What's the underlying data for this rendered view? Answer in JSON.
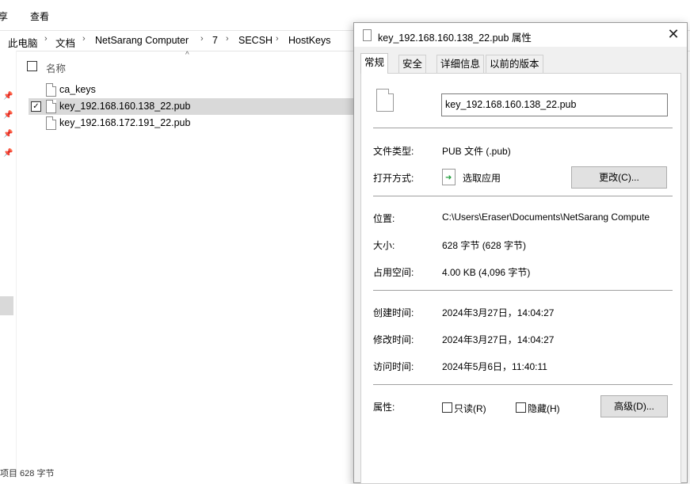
{
  "ribbon": {
    "share_tab": "享",
    "view_tab": "查看"
  },
  "breadcrumb": [
    "此电脑",
    "文档",
    "NetSarang Computer",
    "7",
    "SECSH",
    "HostKeys"
  ],
  "file_list": {
    "column_name": "名称",
    "files": [
      {
        "name": "ca_keys",
        "selected": false
      },
      {
        "name": "key_192.168.160.138_22.pub",
        "selected": true
      },
      {
        "name": "key_192.168.172.191_22.pub",
        "selected": false
      }
    ]
  },
  "status_bar": {
    "text": "项目 628 字节"
  },
  "dialog": {
    "title": "key_192.168.160.138_22.pub 属性",
    "tabs": [
      "常规",
      "安全",
      "详细信息",
      "以前的版本"
    ],
    "active_tab": "常规",
    "filename": "key_192.168.160.138_22.pub",
    "file_type_label": "文件类型:",
    "file_type_value": "PUB 文件 (.pub)",
    "opens_with_label": "打开方式:",
    "opens_with_value": "选取应用",
    "change_button": "更改(C)...",
    "location_label": "位置:",
    "location_value": "C:\\Users\\Eraser\\Documents\\NetSarang Compute",
    "size_label": "大小:",
    "size_value": "628 字节 (628 字节)",
    "size_on_disk_label": "占用空间:",
    "size_on_disk_value": "4.00 KB (4,096 字节)",
    "created_label": "创建时间:",
    "created_value": "2024年3月27日，14:04:27",
    "modified_label": "修改时间:",
    "modified_value": "2024年3月27日，14:04:27",
    "accessed_label": "访问时间:",
    "accessed_value": "2024年5月6日，11:40:11",
    "attributes_label": "属性:",
    "readonly_label": "只读(R)",
    "hidden_label": "隐藏(H)",
    "advanced_button": "高级(D)..."
  }
}
